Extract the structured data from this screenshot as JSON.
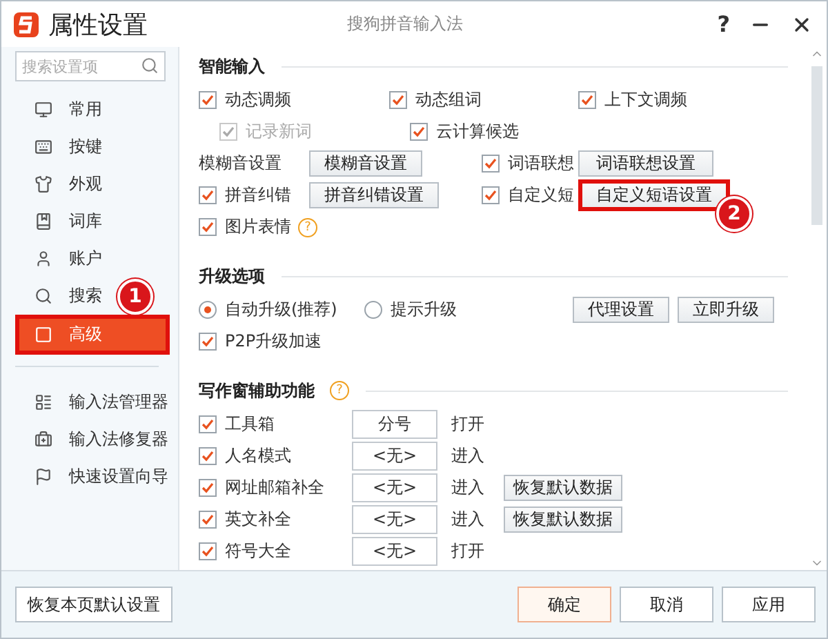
{
  "window": {
    "title": "属性设置",
    "product": "搜狗拼音输入法",
    "help": "?"
  },
  "sidebar": {
    "search": {
      "placeholder": "搜索设置项"
    },
    "items": [
      {
        "label": "常用",
        "selected": false,
        "highlighted": false
      },
      {
        "label": "按键",
        "selected": false,
        "highlighted": false
      },
      {
        "label": "外观",
        "selected": false,
        "highlighted": false
      },
      {
        "label": "词库",
        "selected": false,
        "highlighted": false
      },
      {
        "label": "账户",
        "selected": false,
        "highlighted": false
      },
      {
        "label": "搜索",
        "selected": false,
        "highlighted": false
      },
      {
        "label": "高级",
        "selected": true,
        "highlighted": true,
        "badge": "1"
      }
    ],
    "tools": [
      {
        "label": "输入法管理器"
      },
      {
        "label": "输入法修复器"
      },
      {
        "label": "快速设置向导"
      }
    ]
  },
  "sections": [
    {
      "kind": "smart",
      "title": "智能输入",
      "rows": [
        {
          "kind": "triple",
          "items": [
            {
              "label": "动态调频",
              "checked": true
            },
            {
              "label": "动态组词",
              "checked": true
            },
            {
              "label": "上下文调频",
              "checked": true
            }
          ]
        },
        {
          "kind": "sub",
          "items": [
            {
              "label": "记录新词",
              "checked": true,
              "disabled": true
            },
            {
              "label": "云计算候选",
              "checked": true,
              "disabled": false
            }
          ]
        },
        {
          "kind": "pair",
          "items": [
            {
              "kind": "label",
              "label": "模糊音设置",
              "button": {
                "label": "模糊音设置",
                "highlighted": false
              }
            },
            {
              "kind": "checkbox",
              "label": "词语联想",
              "checked": true,
              "button": {
                "label": "词语联想设置",
                "highlighted": false
              }
            }
          ]
        },
        {
          "kind": "pair",
          "items": [
            {
              "kind": "checkbox",
              "label": "拼音纠错",
              "checked": true,
              "button": {
                "label": "拼音纠错设置",
                "highlighted": false
              }
            },
            {
              "kind": "checkbox",
              "label": "自定义短",
              "checked": true,
              "button": {
                "label": "自定义短语设置",
                "highlighted": true,
                "badge": "2"
              }
            }
          ]
        },
        {
          "kind": "single",
          "items": [
            {
              "label": "图片表情",
              "checked": true,
              "help": "?"
            }
          ]
        }
      ]
    },
    {
      "kind": "upgrade",
      "title": "升级选项",
      "radios": [
        {
          "label": "自动升级(推荐)",
          "selected": true
        },
        {
          "label": "提示升级",
          "selected": false
        }
      ],
      "buttons": [
        {
          "label": "代理设置"
        },
        {
          "label": "立即升级"
        }
      ],
      "options": [
        {
          "label": "P2P升级加速",
          "checked": true
        }
      ]
    },
    {
      "kind": "writing",
      "title": "写作窗辅助功能",
      "help": "?",
      "rows": [
        {
          "label": "工具箱",
          "checked": true,
          "hotkey": "分号",
          "action": "打开"
        },
        {
          "label": "人名模式",
          "checked": true,
          "hotkey": "<无>",
          "action": "进入"
        },
        {
          "label": "网址邮箱补全",
          "checked": true,
          "hotkey": "<无>",
          "action": "进入",
          "button": "恢复默认数据"
        },
        {
          "label": "英文补全",
          "checked": true,
          "hotkey": "<无>",
          "action": "进入",
          "button": "恢复默认数据"
        },
        {
          "label": "符号大全",
          "checked": true,
          "hotkey": "<无>",
          "action": "打开"
        }
      ]
    }
  ],
  "footer": {
    "reset": "恢复本页默认设置",
    "buttons": [
      {
        "label": "确定",
        "primary": true
      },
      {
        "label": "取消",
        "primary": false
      },
      {
        "label": "应用",
        "primary": false
      }
    ]
  }
}
